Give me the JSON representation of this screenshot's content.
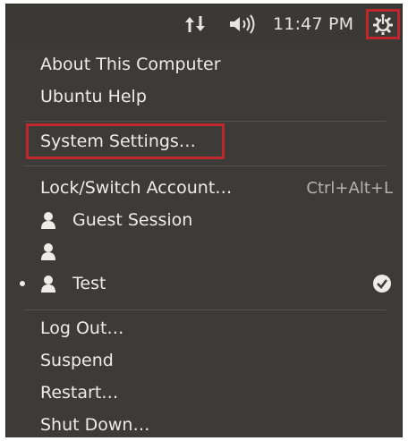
{
  "topbar": {
    "clock": "11:47 PM",
    "icons": [
      "network-icon",
      "volume-icon",
      "power-gear-icon"
    ]
  },
  "menu": {
    "about": "About This Computer",
    "help": "Ubuntu Help",
    "settings": "System Settings…",
    "lock": "Lock/Switch Account…",
    "lock_shortcut": "Ctrl+Alt+L",
    "guest": "Guest Session",
    "blank_user": "",
    "test_user": "Test",
    "logout": "Log Out…",
    "suspend": "Suspend",
    "restart": "Restart…",
    "shutdown": "Shut Down…"
  },
  "colors": {
    "panel": "#3c3b37",
    "highlight_outline": "#c0272d",
    "text": "#efece7"
  }
}
